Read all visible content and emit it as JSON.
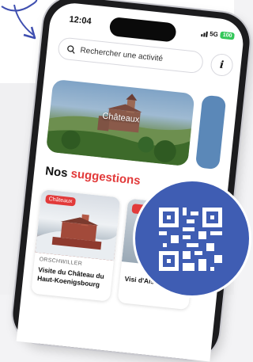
{
  "colors": {
    "accent_red": "#e23a3a",
    "qr_blue": "#3f5db3",
    "arrow_blue": "#3f4fb0"
  },
  "status_bar": {
    "time": "12:04",
    "network": "5G",
    "battery": "100"
  },
  "search": {
    "placeholder": "Rechercher une activité",
    "icon": "search-icon"
  },
  "info_button": {
    "label": "i"
  },
  "category_card": {
    "label": "Châteaux"
  },
  "suggestions": {
    "title_part1": "Nos ",
    "title_part2": "suggestions",
    "items": [
      {
        "badge": "Châteaux",
        "place": "ORSCHWILLER",
        "title": "Visite du Château du Haut-Koenigsbourg"
      },
      {
        "title": "Visi d'Als"
      }
    ]
  },
  "qr": {
    "icon": "qr-code-icon"
  }
}
